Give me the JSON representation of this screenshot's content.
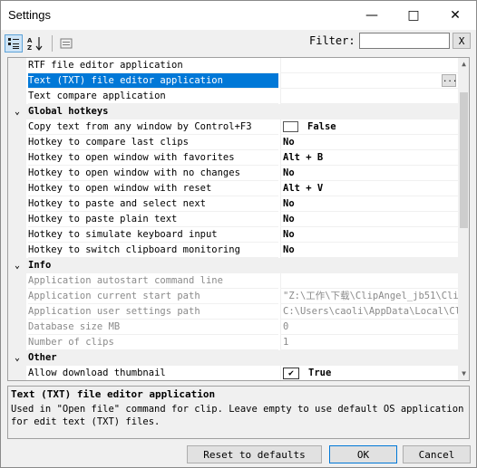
{
  "window": {
    "title": "Settings"
  },
  "toolbar": {
    "filter_label": "Filter:",
    "filter_value": "",
    "clear_label": "X"
  },
  "sections": [
    {
      "kind": "row",
      "name": "RTF file editor application",
      "value": ""
    },
    {
      "kind": "row",
      "name": "Text (TXT) file editor application",
      "value": "",
      "selected": true,
      "button": "..."
    },
    {
      "kind": "row",
      "name": "Text compare application",
      "value": ""
    },
    {
      "kind": "cat",
      "name": "Global hotkeys",
      "toggle": "⌄"
    },
    {
      "kind": "row",
      "name": "Copy text from any window by Control+F3",
      "value": "False",
      "bold": true,
      "swatch": "empty"
    },
    {
      "kind": "row",
      "name": "Hotkey to compare last clips",
      "value": "No",
      "bold": true
    },
    {
      "kind": "row",
      "name": "Hotkey to open window with favorites",
      "value": "Alt + B",
      "bold": true
    },
    {
      "kind": "row",
      "name": "Hotkey to open window with no changes",
      "value": "No",
      "bold": true
    },
    {
      "kind": "row",
      "name": "Hotkey to open window with reset",
      "value": "Alt + V",
      "bold": true
    },
    {
      "kind": "row",
      "name": "Hotkey to paste and select next",
      "value": "No",
      "bold": true
    },
    {
      "kind": "row",
      "name": "Hotkey to paste plain text",
      "value": "No",
      "bold": true
    },
    {
      "kind": "row",
      "name": "Hotkey to simulate keyboard input",
      "value": "No",
      "bold": true
    },
    {
      "kind": "row",
      "name": "Hotkey to switch clipboard monitoring",
      "value": "No",
      "bold": true
    },
    {
      "kind": "cat",
      "name": "Info",
      "toggle": "⌄"
    },
    {
      "kind": "row",
      "name": "Application autostart command line",
      "value": "",
      "dim": true
    },
    {
      "kind": "row",
      "name": "Application current start path",
      "value": "\"Z:\\工作\\下载\\ClipAngel_jb51\\Cli",
      "dim": true
    },
    {
      "kind": "row",
      "name": "Application user settings path",
      "value": "C:\\Users\\caoli\\AppData\\Local\\Cli",
      "dim": true
    },
    {
      "kind": "row",
      "name": "Database size MB",
      "value": "0",
      "dim": true
    },
    {
      "kind": "row",
      "name": "Number of clips",
      "value": "1",
      "dim": true
    },
    {
      "kind": "cat",
      "name": "Other",
      "toggle": "⌄"
    },
    {
      "kind": "row",
      "name": "Allow download thumbnail",
      "value": "True",
      "bold": true,
      "check": "✔"
    }
  ],
  "description": {
    "title": "Text (TXT) file editor application",
    "text": "Used in \"Open file\" command for clip. Leave empty to use default OS application for edit text (TXT) files."
  },
  "buttons": {
    "reset": "Reset to defaults",
    "ok": "OK",
    "cancel": "Cancel"
  },
  "colors": {
    "selection": "#0078d7",
    "category_bg": "#f0f0f0"
  }
}
